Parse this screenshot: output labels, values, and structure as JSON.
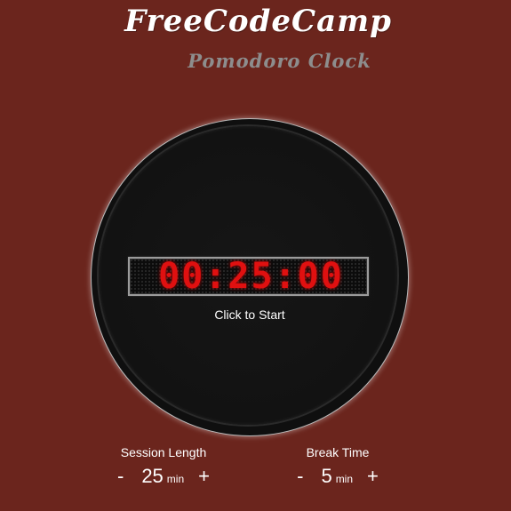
{
  "header": {
    "title": "FreeCodeCamp",
    "subtitle": "Pomodoro Clock"
  },
  "clock": {
    "time": "00:25:00",
    "status": "Click to Start"
  },
  "session": {
    "label": "Session Length",
    "minus": "-",
    "value": "25",
    "unit": "min",
    "plus": "+"
  },
  "break": {
    "label": "Break Time",
    "minus": "-",
    "value": "5",
    "unit": "min",
    "plus": "+"
  },
  "colors": {
    "background": "#6b251d",
    "display_digits": "#e01010",
    "clock_face": "#121212"
  }
}
